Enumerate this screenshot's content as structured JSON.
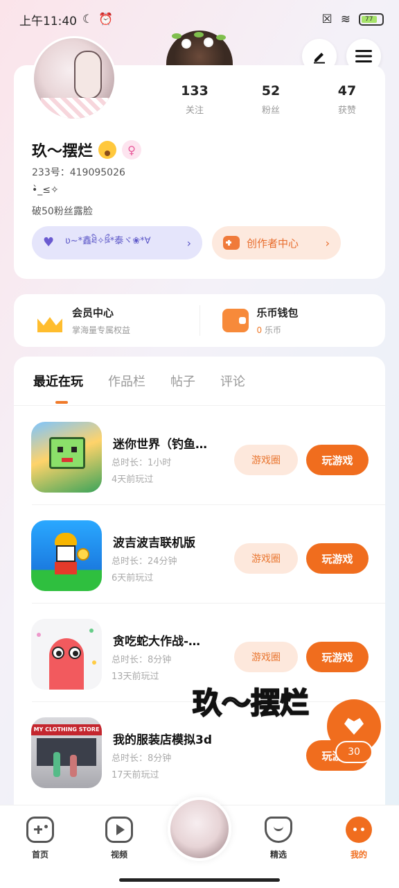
{
  "status_bar": {
    "time": "上午11:40",
    "battery": "77"
  },
  "profile": {
    "nickname": "玖～摆烂",
    "uid": "233号：419095026",
    "signature1": "•̀_≤✧",
    "signature2": "破50粉丝露脸",
    "stats": [
      {
        "value": "133",
        "label": "关注"
      },
      {
        "value": "52",
        "label": "粉丝"
      },
      {
        "value": "47",
        "label": "获赞"
      }
    ],
    "badge_text": "ʋ~*鑫ཐི✧ཋྀ*泰ヾ❀*∀",
    "creator_center": "创作者中心"
  },
  "wallet": {
    "member_title": "会员中心",
    "member_sub": "掌海量专属权益",
    "coin_title": "乐币钱包",
    "coin_amount": "0",
    "coin_unit": "乐币"
  },
  "tabs": [
    "最近在玩",
    "作品栏",
    "帖子",
    "评论"
  ],
  "games": [
    {
      "title": "迷你世界（钓鱼…",
      "duration": "总时长：1小时",
      "last_played": "4天前玩过"
    },
    {
      "title": "波吉波吉联机版",
      "duration": "总时长：24分钟",
      "last_played": "6天前玩过"
    },
    {
      "title": "贪吃蛇大作战-…",
      "duration": "总时长：8分钟",
      "last_played": "13天前玩过"
    },
    {
      "title": "我的服装店模拟3d",
      "duration": "总时长：8分钟",
      "last_played": "17天前玩过"
    }
  ],
  "buttons": {
    "circle": "游戏圈",
    "play": "玩游戏"
  },
  "overlay": {
    "name": "玖～摆烂",
    "count": "30"
  },
  "bottom_nav": [
    {
      "label": "首页"
    },
    {
      "label": "视频"
    },
    {
      "label": "精选"
    },
    {
      "label": "我的"
    }
  ],
  "colors": {
    "accent": "#f06d1e",
    "badge": "#5b56c7"
  }
}
